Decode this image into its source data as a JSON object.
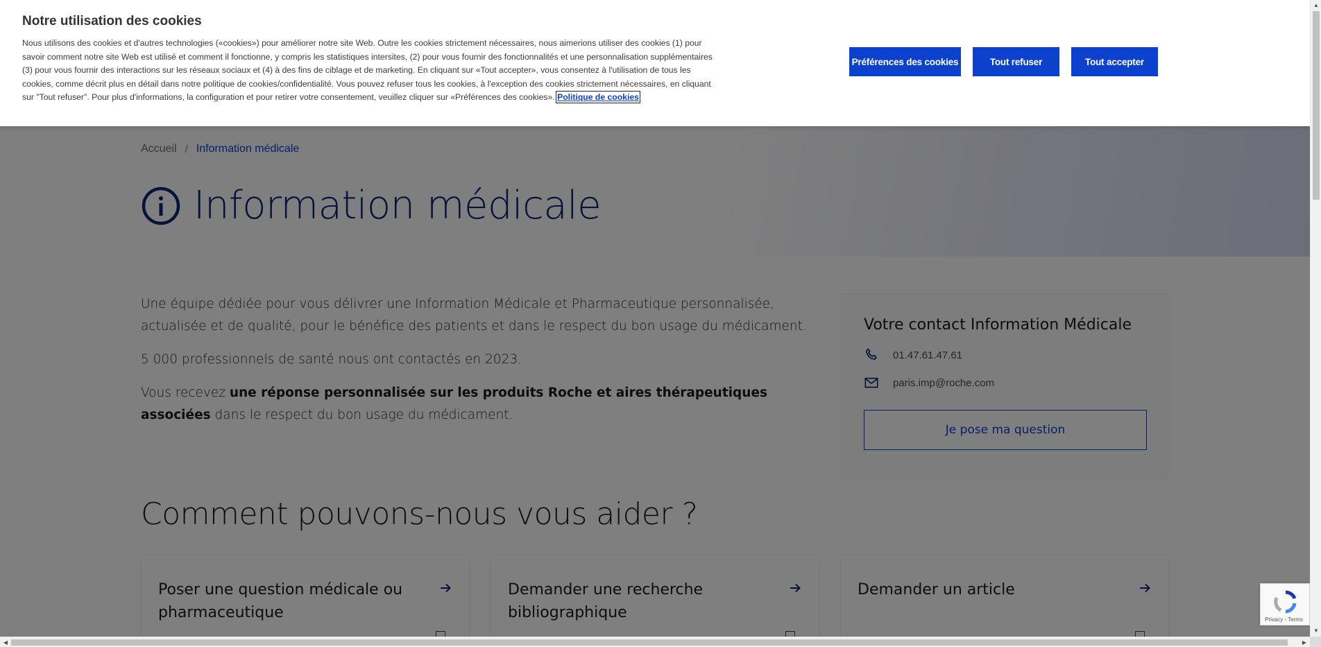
{
  "cookie_banner": {
    "title": "Notre utilisation des cookies",
    "description": "Nous utilisons des cookies et d'autres technologies («cookies») pour améliorer notre site Web. Outre les cookies strictement nécessaires, nous aimerions utiliser des cookies (1) pour savoir comment notre site Web est utilisé et comment il fonctionne, y compris les statistiques intersites, (2) pour vous fournir des fonctionnalités et une personnalisation supplémentaires (3) pour vous fournir des interactions sur les réseaux sociaux et (4) à des fins de ciblage et de marketing. En cliquant sur «Tout accepter», vous consentez à l'utilisation de tous les cookies, comme décrit plus en détail dans notre politique de cookies/confidentialité. Vous pouvez refuser tous les cookies, à l'exception des cookies strictement nécessaires, en cliquant sur \"Tout refuser\". Pour plus d'informations, la configuration et pour retirer votre consentement, veuillez cliquer sur «Préférences des cookies».",
    "policy_link": "Politique de cookies",
    "btn_preferences": "Préférences des cookies",
    "btn_refuse": "Tout refuser",
    "btn_accept": "Tout accepter"
  },
  "breadcrumb": {
    "home": "Accueil",
    "separator": "/",
    "current": "Information médicale"
  },
  "hero": {
    "icon": "info-circle-icon",
    "title": "Information médicale"
  },
  "intro": {
    "p1": "Une équipe dédiée pour vous délivrer une Information Médicale et Pharmaceutique personnalisée, actualisée et de qualité, pour le bénéfice des patients et dans le respect du bon usage du médicament.",
    "p2": "5 000 professionnels de santé nous ont contactés en 2023.",
    "p3_before": "Vous recevez ",
    "p3_bold": "une réponse personnalisée sur les produits Roche et aires thérapeutiques associées",
    "p3_after": " dans le respect du bon usage du médicament."
  },
  "contact": {
    "title": "Votre contact Information Médicale",
    "phone_icon": "phone-icon",
    "phone": "01.47.61.47.61",
    "email_icon": "mail-icon",
    "email": "paris.imp@roche.com",
    "button": "Je pose ma question"
  },
  "help": {
    "title": "Comment pouvons-nous vous aider ?",
    "cards": [
      {
        "title": "Poser une question médicale ou pharmaceutique"
      },
      {
        "title": "Demander une recherche bibliographique"
      },
      {
        "title": "Demander un article"
      }
    ]
  },
  "recaptcha": {
    "text": "Privacy - Terms"
  },
  "colors": {
    "brand_blue": "#0b41cd",
    "title_navy": "#0a2472"
  }
}
